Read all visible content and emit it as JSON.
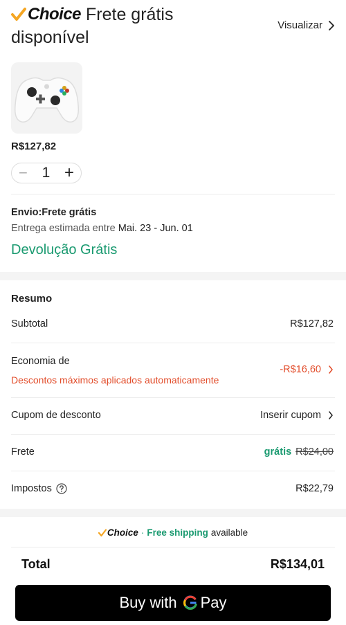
{
  "header": {
    "choice_word": "Choice",
    "title_line1": "Frete grátis",
    "title_line2": "disponível",
    "view_link": "Visualizar"
  },
  "product": {
    "image_icon": "game-controller",
    "price": "R$127,82",
    "quantity": "1",
    "minus": "−",
    "plus": "+"
  },
  "shipping": {
    "label": "Envio:Frete grátis",
    "delivery_prefix": "Entrega estimada entre",
    "delivery_dates": "Mai. 23 - Jun. 01",
    "returns": "Devolução Grátis"
  },
  "summary": {
    "title": "Resumo",
    "subtotal_label": "Subtotal",
    "subtotal_value": "R$127,82",
    "savings_label": "Economia de",
    "savings_sub": "Descontos máximos aplicados automaticamente",
    "savings_value": "-R$16,60",
    "coupon_label": "Cupom de desconto",
    "coupon_value": "Inserir cupom",
    "shipping_label": "Frete",
    "shipping_free": "grátis",
    "shipping_original": "R$24,00",
    "tax_label": "Impostos",
    "tax_value": "R$22,79"
  },
  "footer": {
    "choice_word": "Choice",
    "separator": "·",
    "free_shipping": "Free shipping",
    "available": "available",
    "total_label": "Total",
    "total_value": "R$134,01",
    "pay_prefix": "Buy with",
    "pay_suffix": "Pay"
  },
  "colors": {
    "accent_green": "#1a9a70",
    "accent_red": "#e24d2b",
    "choice_check": "#f5a623",
    "pay_button": "#000000"
  }
}
